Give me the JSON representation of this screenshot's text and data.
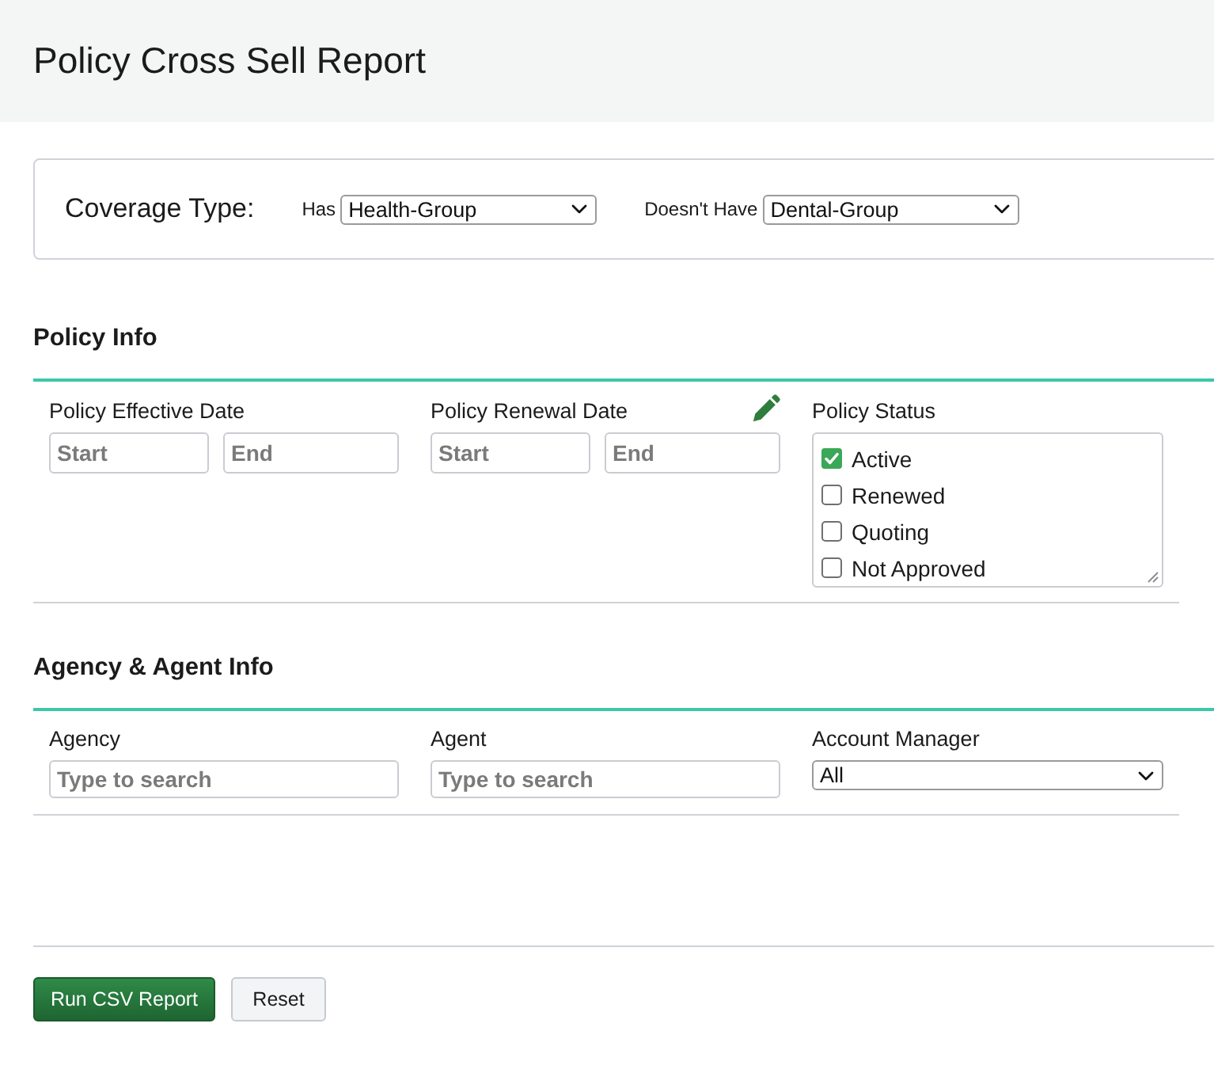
{
  "page": {
    "title": "Policy Cross Sell Report"
  },
  "coverage": {
    "label": "Coverage Type:",
    "filters": [
      {
        "label": "Has",
        "value": "Health-Group"
      },
      {
        "label": "Doesn't Have",
        "value": "Dental-Group"
      }
    ]
  },
  "sections": [
    {
      "title": "Policy Info",
      "fields": [
        {
          "kind": "date_range",
          "label": "Policy Effective Date",
          "inputs": [
            {
              "placeholder": "Start"
            },
            {
              "placeholder": "End"
            }
          ]
        },
        {
          "kind": "date_range",
          "label": "Policy Renewal Date",
          "edit_icon": true,
          "inputs": [
            {
              "placeholder": "Start"
            },
            {
              "placeholder": "End"
            }
          ]
        },
        {
          "kind": "checklist",
          "label": "Policy Status",
          "options": [
            {
              "label": "Active",
              "checked": true
            },
            {
              "label": "Renewed",
              "checked": false
            },
            {
              "label": "Quoting",
              "checked": false
            },
            {
              "label": "Not Approved",
              "checked": false
            }
          ]
        }
      ]
    },
    {
      "title": "Agency & Agent Info",
      "fields": [
        {
          "kind": "search",
          "label": "Agency",
          "placeholder": "Type to search"
        },
        {
          "kind": "search",
          "label": "Agent",
          "placeholder": "Type to search"
        },
        {
          "kind": "select",
          "label": "Account Manager",
          "value": "All"
        }
      ]
    }
  ],
  "buttons": [
    {
      "label": "Run CSV Report",
      "kind": "primary"
    },
    {
      "label": "Reset",
      "kind": "secondary"
    }
  ]
}
